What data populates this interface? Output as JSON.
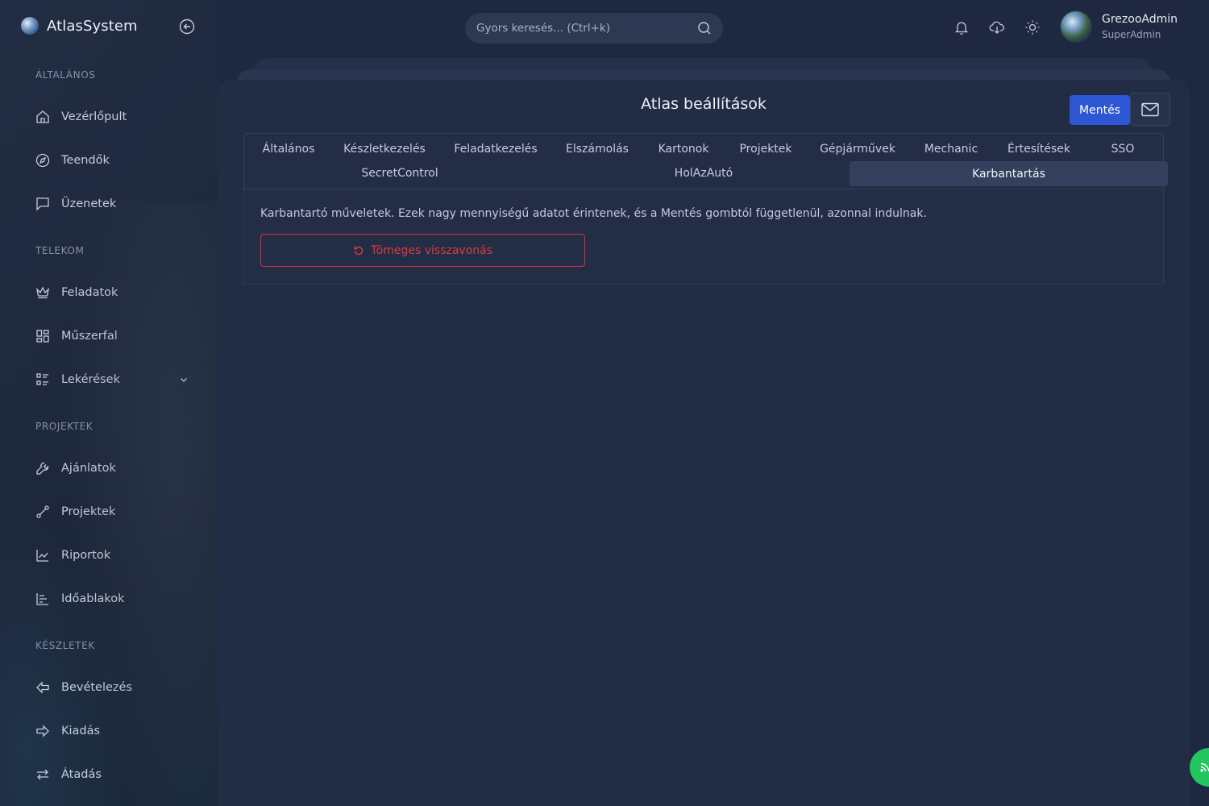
{
  "app": {
    "name": "AtlasSystem"
  },
  "search": {
    "placeholder": "Gyors keresés... (Ctrl+k)"
  },
  "user": {
    "name": "GrezooAdmin",
    "role": "SuperAdmin"
  },
  "sidebar": {
    "sections": [
      {
        "title": "ÁLTALÁNOS",
        "items": [
          {
            "label": "Vezérlőpult",
            "icon": "home-icon"
          },
          {
            "label": "Teendők",
            "icon": "compass-icon"
          },
          {
            "label": "Üzenetek",
            "icon": "message-icon"
          }
        ]
      },
      {
        "title": "TELEKOM",
        "items": [
          {
            "label": "Feladatok",
            "icon": "crown-icon"
          },
          {
            "label": "Műszerfal",
            "icon": "dashboard-icon"
          },
          {
            "label": "Lekérések",
            "icon": "list-icon"
          }
        ]
      },
      {
        "title": "PROJEKTEK",
        "items": [
          {
            "label": "Ajánlatok",
            "icon": "wrench-icon"
          },
          {
            "label": "Projektek",
            "icon": "route-icon"
          },
          {
            "label": "Riportok",
            "icon": "line-chart-icon"
          },
          {
            "label": "Időablakok",
            "icon": "timeline-icon"
          }
        ]
      },
      {
        "title": "KÉSZLETEK",
        "items": [
          {
            "label": "Bevételezés",
            "icon": "arrow-left-icon"
          },
          {
            "label": "Kiadás",
            "icon": "arrow-right-icon"
          },
          {
            "label": "Átadás",
            "icon": "swap-icon"
          }
        ]
      }
    ]
  },
  "page": {
    "title": "Atlas beállítások",
    "save_label": "Mentés"
  },
  "tabs": [
    "Általános",
    "Készletkezelés",
    "Feladatkezelés",
    "Elszámolás",
    "Kartonok",
    "Projektek",
    "Gépjárművek",
    "Mechanic",
    "Értesítések",
    "SSO",
    "SecretControl",
    "HolAzAutó",
    "Karbantartás"
  ],
  "active_tab": "Karbantartás",
  "maintenance": {
    "description": "Karbantartó műveletek. Ezek nagy mennyiségű adatot érintenek, és a Mentés gombtól függetlenül, azonnal indulnak.",
    "bulk_revert_label": "Tömeges visszavonás"
  },
  "colors": {
    "primary": "#2e57d6",
    "danger": "#dd3a40",
    "fab": "#22c55e"
  }
}
